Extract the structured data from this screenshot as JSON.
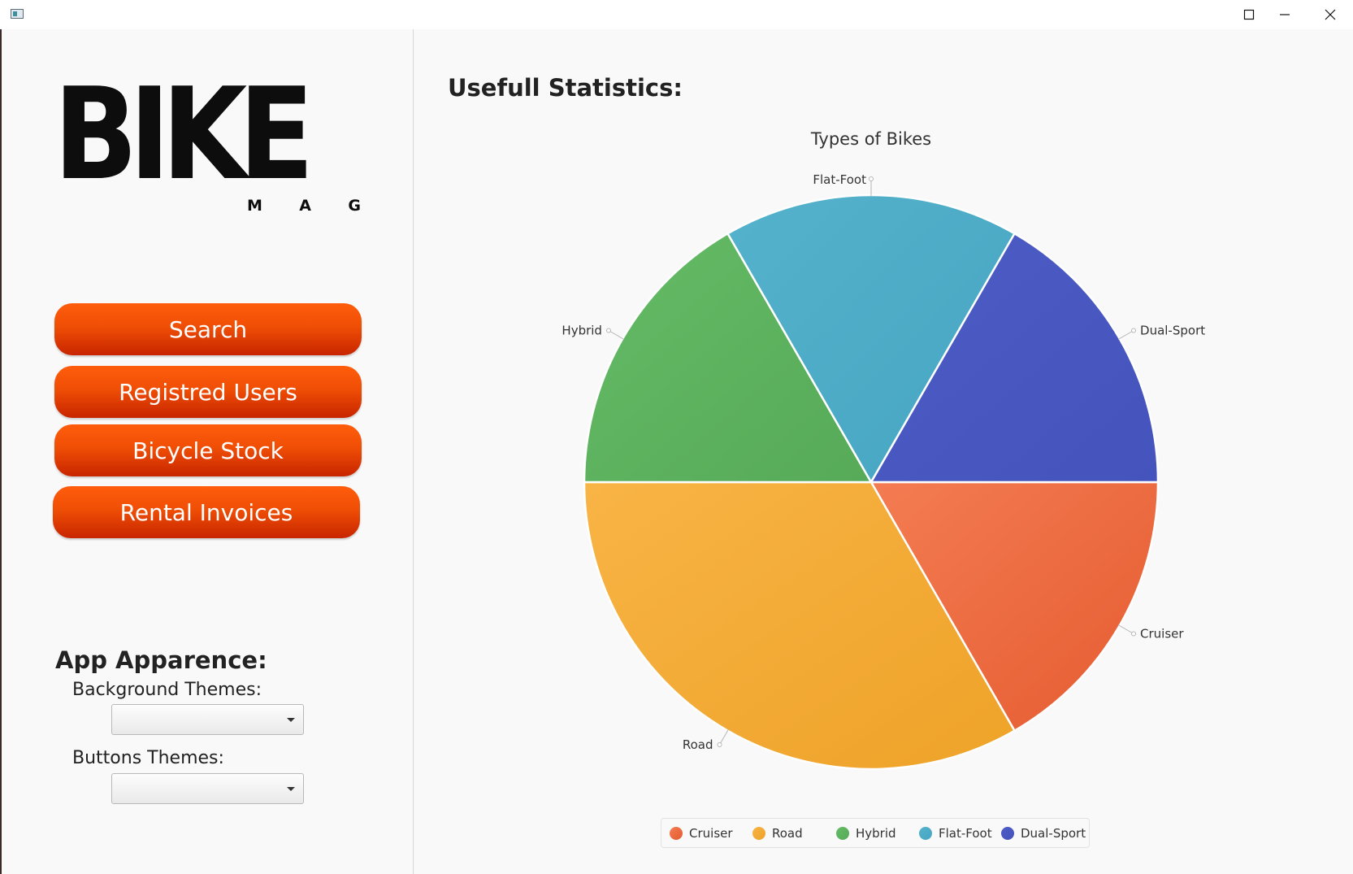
{
  "window": {
    "minimize_icon": "minimize-icon",
    "maximize_icon": "maximize-icon",
    "close_icon": "close-icon"
  },
  "logo": {
    "main_text": "BIKE",
    "sub_letters": [
      "M",
      "A",
      "G"
    ]
  },
  "nav": {
    "search_label": "Search",
    "users_label": "Registred Users",
    "stock_label": "Bicycle Stock",
    "invoices_label": "Rental Invoices",
    "button_color": "#e84a06"
  },
  "appearance": {
    "heading": "App Apparence:",
    "background_label": "Background Themes:",
    "background_value": "",
    "buttons_label": "Buttons Themes:",
    "buttons_value": ""
  },
  "main": {
    "heading": "Usefull Statistics:"
  },
  "chart_data": {
    "type": "pie",
    "title": "Types of Bikes",
    "categories": [
      "Cruiser",
      "Road",
      "Hybrid",
      "Flat-Foot",
      "Dual-Sport"
    ],
    "values": [
      1,
      2,
      1,
      1,
      1
    ],
    "colors": [
      "#e55b30",
      "#eea228",
      "#56aa58",
      "#46a5c2",
      "#4553bd"
    ],
    "colors_light": [
      "#f47c52",
      "#f8b445",
      "#65bb66",
      "#55b2cc",
      "#4d5dc4"
    ],
    "start_angle_deg": 0,
    "direction": "clockwise",
    "legend_position": "bottom"
  }
}
